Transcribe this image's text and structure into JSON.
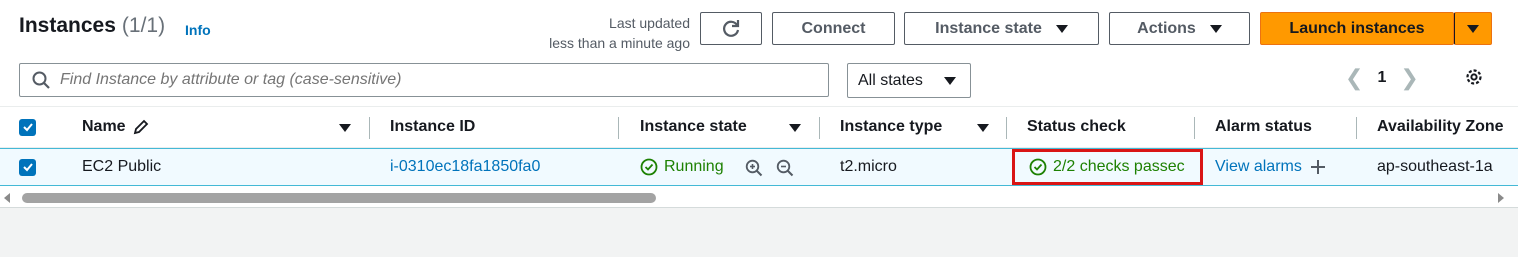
{
  "header": {
    "title": "Instances",
    "count": "(1/1)",
    "info_link": "Info",
    "last_updated_line1": "Last updated",
    "last_updated_line2": "less than a minute ago",
    "refresh_icon": "refresh-icon",
    "connect_label": "Connect",
    "instance_state_label": "Instance state",
    "actions_label": "Actions",
    "launch_label": "Launch instances"
  },
  "filter": {
    "search_placeholder": "Find Instance by attribute or tag (case-sensitive)",
    "states_select": "All states"
  },
  "pagination": {
    "current_page": "1"
  },
  "table": {
    "columns": [
      "Name",
      "Instance ID",
      "Instance state",
      "Instance type",
      "Status check",
      "Alarm status",
      "Availability Zone"
    ],
    "rows": [
      {
        "name": "EC2 Public",
        "instance_id": "i-0310ec18fa1850fa0",
        "instance_state": "Running",
        "instance_type": "t2.micro",
        "status_check": "2/2 checks passec",
        "alarm_status": "View alarms",
        "availability_zone": "ap-southeast-1a"
      }
    ]
  },
  "colors": {
    "accent": "#0073bb",
    "primary_button": "#ff9900",
    "success": "#1d8102",
    "highlight": "#d91515"
  }
}
